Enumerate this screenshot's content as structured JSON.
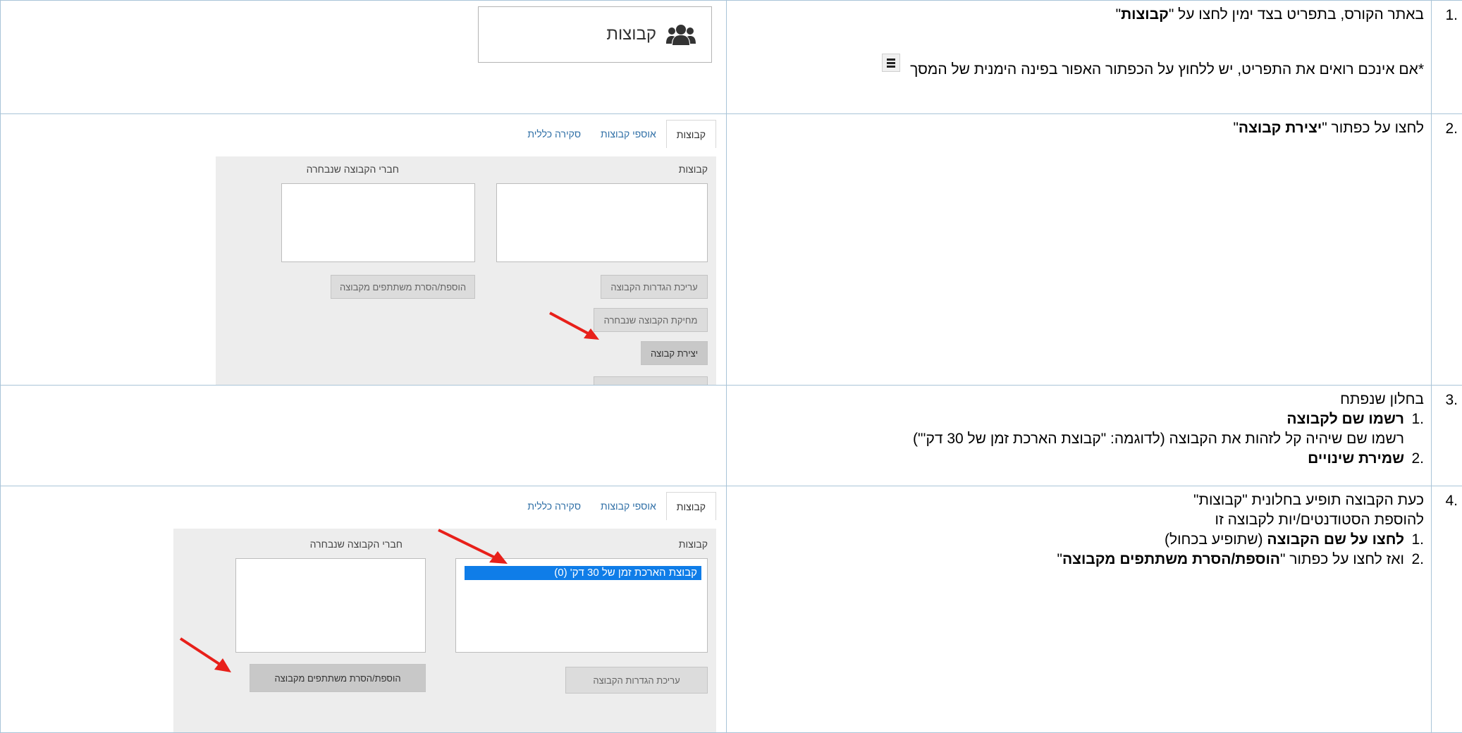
{
  "steps": [
    {
      "num": ".1",
      "line1_pre": "באתר הקורס, בתפריט בצד ימין לחצו על \"",
      "line1_bold": "קבוצות",
      "line1_post": "\"",
      "line2": "*אם אינכם רואים את התפריט, יש ללחוץ על הכפתור האפור בפינה הימנית של המסך",
      "image": {
        "groups_label": "קבוצות",
        "icon": "users-icon",
        "menu_icon": "hamburger-menu-icon"
      }
    },
    {
      "num": ".2",
      "line1_pre": "לחצו על כפתור \"",
      "line1_bold": "יצירת קבוצה",
      "line1_post": "\"",
      "image": {
        "tabs": [
          "קבוצות",
          "אוספי קבוצות",
          "סקירה כללית"
        ],
        "groups_label": "קבוצות",
        "members_label": "חברי הקבוצה שנבחרה",
        "btn_edit": "עריכת הגדרות הקבוצה",
        "btn_delete": "מחיקת הקבוצה שנבחרה",
        "btn_create": "יצירת קבוצה",
        "btn_addremove": "הוספת/הסרת משתתפים מקבוצה"
      }
    },
    {
      "num": ".3",
      "line1": "בחלון שנפתח",
      "sub1_num": ".1",
      "sub1_bold": "רשמו שם לקבוצה",
      "sub1_desc": "רשמו שם שיהיה קל לזהות את הקבוצה (לדוגמה: \"קבוצת הארכת זמן של 30 דק'\")",
      "sub2_num": ".2",
      "sub2_bold": "שמירת שינויים"
    },
    {
      "num": ".4",
      "line1": "כעת הקבוצה תופיע בחלונית \"קבוצות\"",
      "line2": "להוספת הסטודנטים/יות לקבוצה זו",
      "sub1_num": ".1",
      "sub1_bold": "לחצו על שם הקבוצה",
      "sub1_rest": " (שתופיע בכחול)",
      "sub2_num": ".2",
      "sub2_pre": "ואז לחצו על כפתור \"",
      "sub2_bold": "הוספת/הסרת משתתפים מקבוצה",
      "sub2_post": "\"",
      "image": {
        "tabs": [
          "קבוצות",
          "אוספי קבוצות",
          "סקירה כללית"
        ],
        "groups_label": "קבוצות",
        "members_label": "חברי הקבוצה שנבחרה",
        "selected_group": "קבוצת הארכת זמן של 30 דק' (0)",
        "btn_edit": "עריכת הגדרות הקבוצה",
        "btn_addremove": "הוספת/הסרת משתתפים מקבוצה"
      }
    }
  ],
  "colors": {
    "border": "#a9c4d8",
    "selection": "#0f7de8",
    "arrow": "#e8201a",
    "link": "#2f6fa6"
  }
}
